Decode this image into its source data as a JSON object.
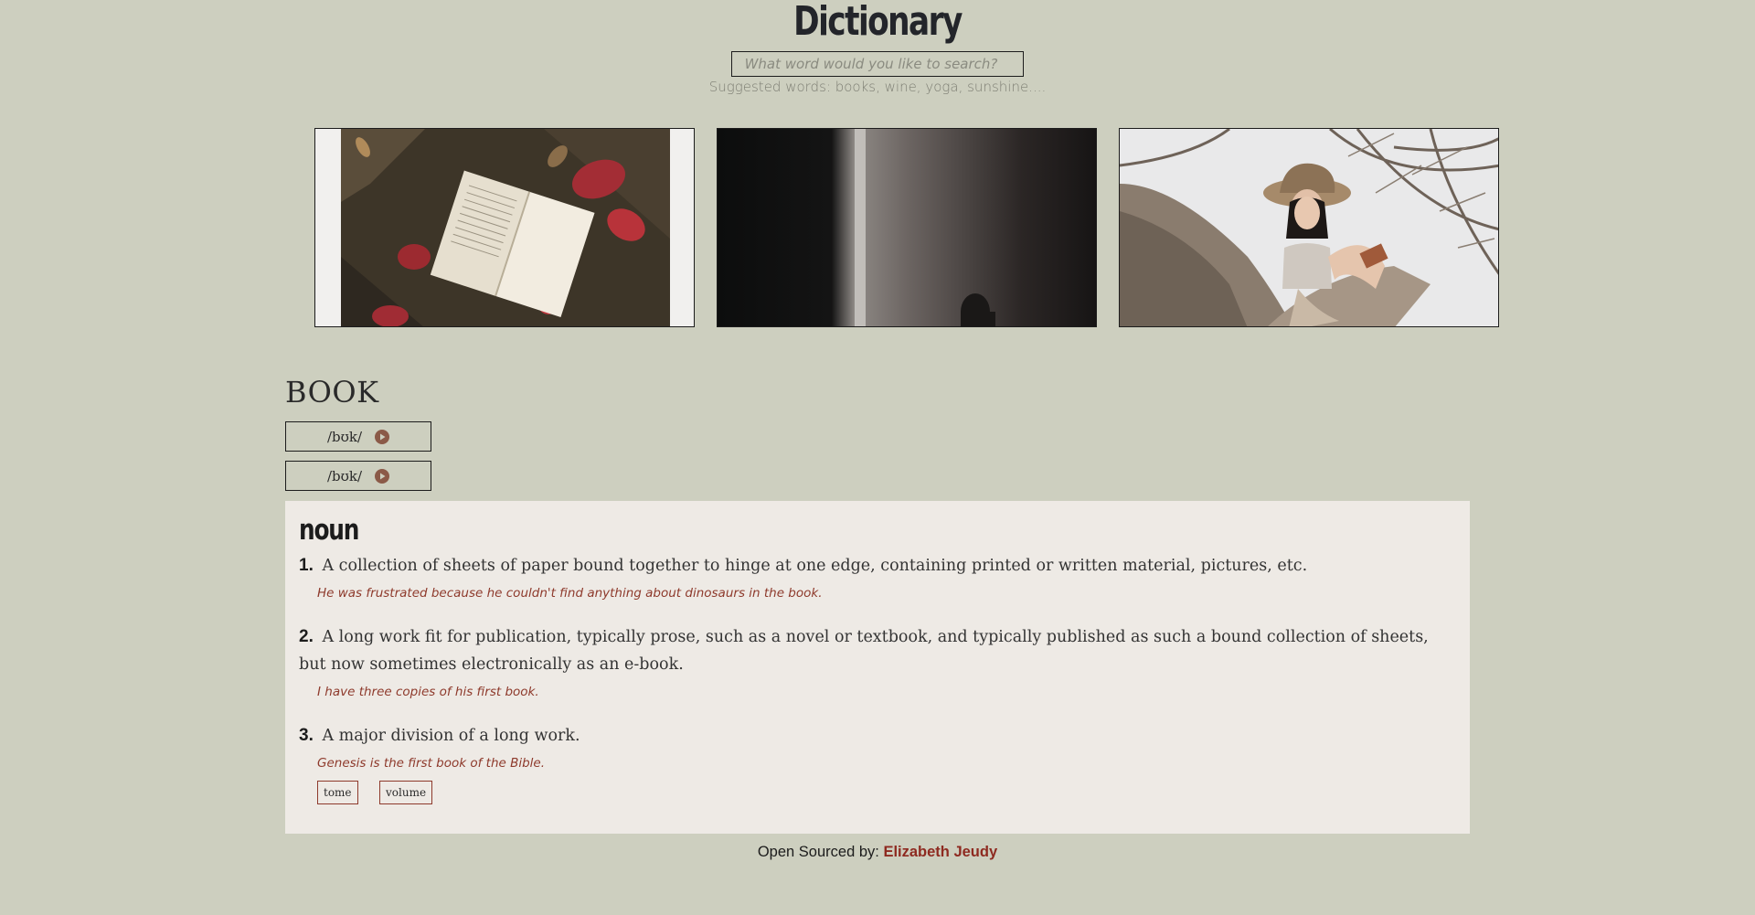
{
  "header": {
    "title": "Dictionary",
    "search_placeholder": "What word would you like to search?",
    "search_value": "",
    "suggestions": "Suggested words: books, wine, yoga, sunshine...."
  },
  "photos": [
    {
      "icon": "photo-open-book-leaves"
    },
    {
      "icon": "photo-dark-wall-shadow"
    },
    {
      "icon": "photo-woman-hat-tree"
    }
  ],
  "word": {
    "title": "BOOK",
    "phonetics": [
      {
        "text": "/bʊk/",
        "icon": "play-icon"
      },
      {
        "text": "/bʊk/",
        "icon": "play-icon"
      }
    ]
  },
  "meaning": {
    "part_of_speech": "noun",
    "definitions": [
      {
        "number": "1.",
        "text": "A collection of sheets of paper bound together to hinge at one edge, containing printed or written material, pictures, etc.",
        "example": "He was frustrated because he couldn't find anything about dinosaurs in the book."
      },
      {
        "number": "2.",
        "text": "A long work fit for publication, typically prose, such as a novel or textbook, and typically published as such a bound collection of sheets, but now sometimes electronically as an e-book.",
        "example": "I have three copies of his first book."
      },
      {
        "number": "3.",
        "text": "A major division of a long work.",
        "example": "Genesis is the first book of the Bible."
      }
    ],
    "synonyms": [
      "tome",
      "volume"
    ]
  },
  "footer": {
    "label": "Open Sourced by:",
    "author": "Elizabeth Jeudy"
  },
  "colors": {
    "background": "#cdcfbf",
    "card": "#eeeae5",
    "accent": "#8e3a2c",
    "play_icon": "#8b5a48"
  }
}
